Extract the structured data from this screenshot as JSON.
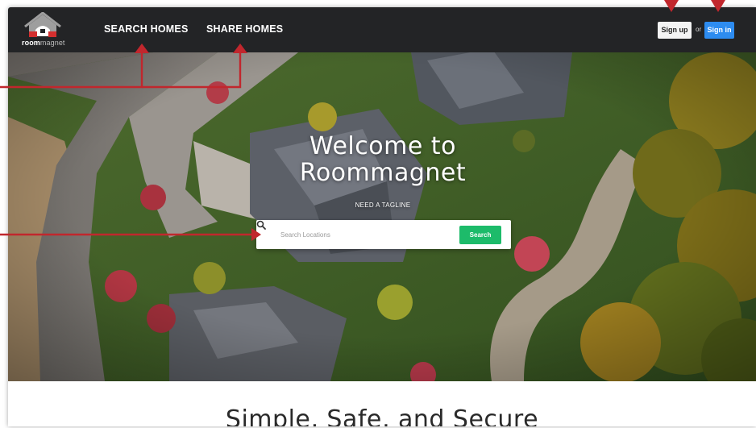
{
  "navbar": {
    "logo": {
      "word_bold": "room",
      "word_light": "magnet"
    },
    "links": [
      {
        "label": "SEARCH HOMES"
      },
      {
        "label": "SHARE HOMES"
      }
    ],
    "signup_label": "Sign up",
    "or_label": "or",
    "signin_label": "Sign in",
    "background": "#232426",
    "signin_color": "#2d8cf0"
  },
  "hero": {
    "title_line1": "Welcome to",
    "title_line2": "Roommagnet",
    "tagline": "NEED A TAGLINE",
    "search": {
      "placeholder": "Search Locations",
      "value": "",
      "button_label": "Search",
      "button_color": "#1dbb6a"
    }
  },
  "section": {
    "heading": "Simple, Safe, and Secure"
  },
  "annotations": {
    "color": "#c1272d",
    "icon": "arrow-marker"
  }
}
